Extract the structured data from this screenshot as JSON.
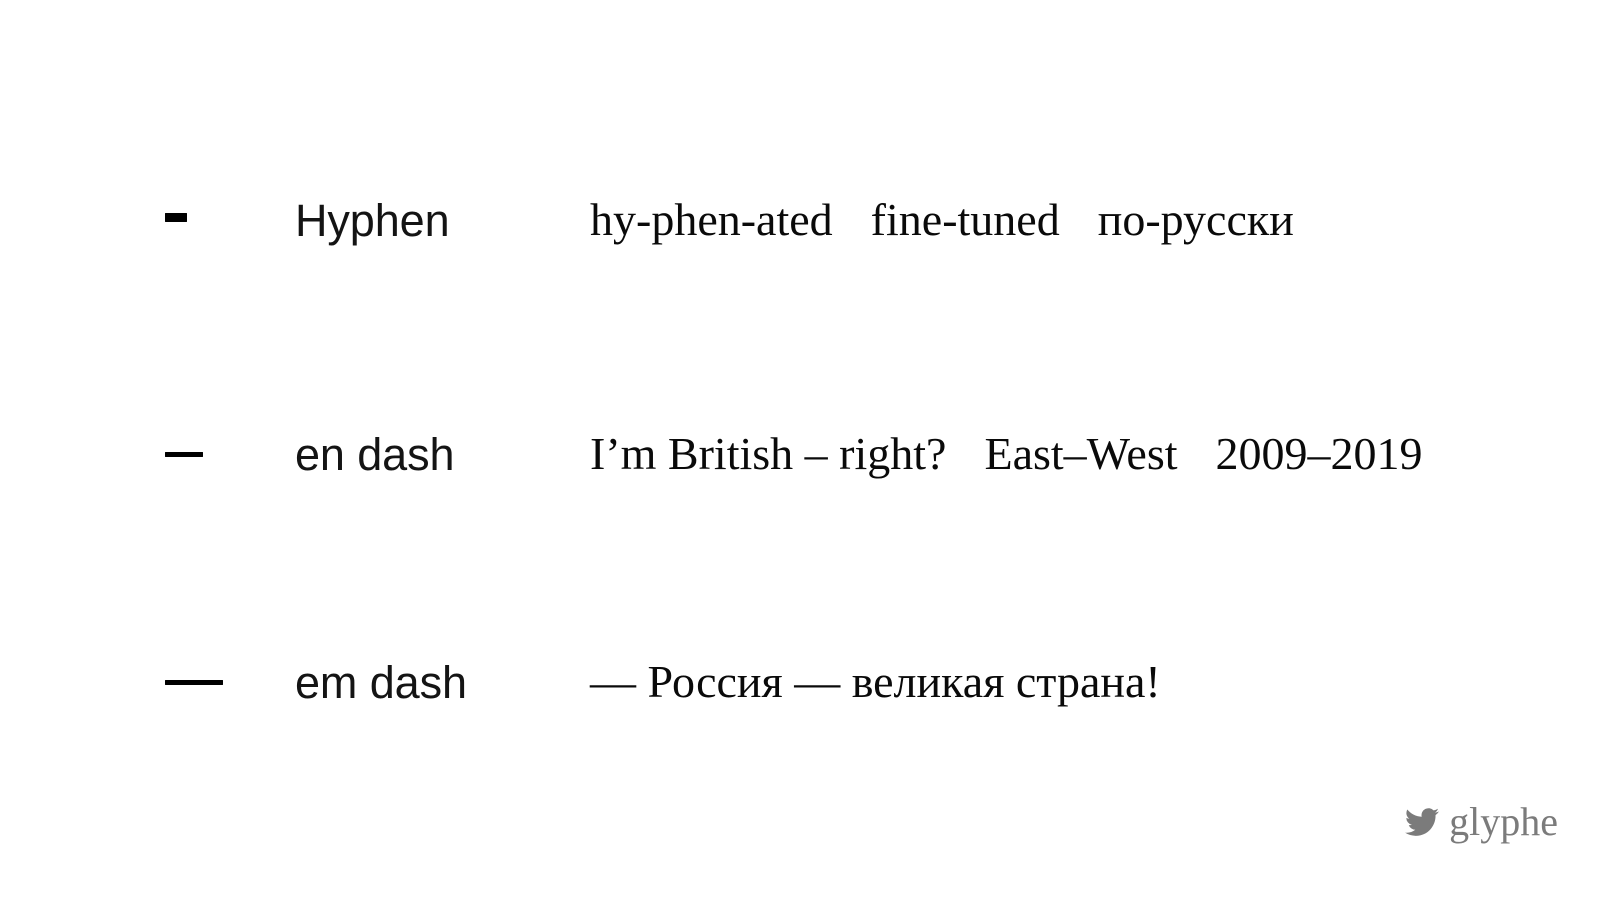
{
  "slide": {
    "background_color": "#ffffff",
    "text_color": "#0a0a0a",
    "label_color": "#141414",
    "watermark_color": "#7b7b7b"
  },
  "rows": [
    {
      "glyph": "-",
      "glyph_icon_name": "hyphen-glyph-icon",
      "name": "Hyphen",
      "examples": [
        "hy-phen-ated",
        "fine-tuned",
        "по-русски"
      ]
    },
    {
      "glyph": "–",
      "glyph_icon_name": "en-dash-glyph-icon",
      "name": "en dash",
      "examples": [
        "I’m British – right?",
        "East–West",
        "2009–2019"
      ]
    },
    {
      "glyph": "—",
      "glyph_icon_name": "em-dash-glyph-icon",
      "name": "em dash",
      "examples": [
        "— Россия — великая страна!"
      ]
    }
  ],
  "watermark": {
    "icon": "twitter-bird-icon",
    "handle": "glyphe"
  }
}
